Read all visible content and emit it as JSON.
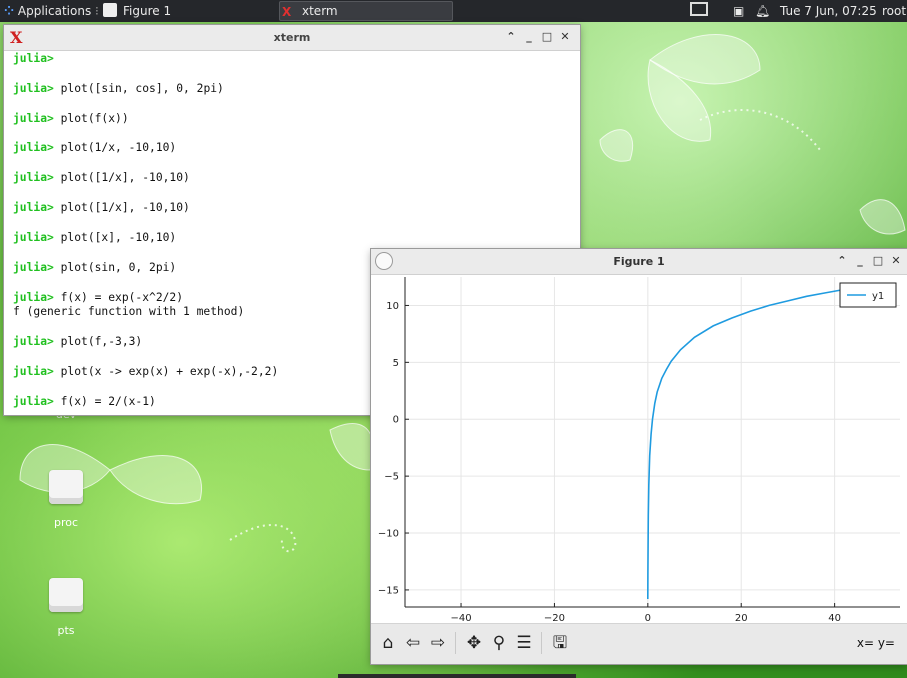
{
  "panel": {
    "applications_label": "Applications",
    "tasks": [
      {
        "label": "Figure 1",
        "icon": "figure-app-icon"
      },
      {
        "label": "xterm",
        "icon": "xterm-app-icon"
      }
    ],
    "clock": "Tue  7 Jun, 07:25",
    "user": "root"
  },
  "xterm": {
    "title": "xterm",
    "lines": [
      {
        "prompt": "julia>",
        "text": ""
      },
      {
        "prompt": "",
        "text": ""
      },
      {
        "prompt": "julia>",
        "text": " plot([sin, cos], 0, 2pi)"
      },
      {
        "prompt": "",
        "text": ""
      },
      {
        "prompt": "julia>",
        "text": " plot(f(x))"
      },
      {
        "prompt": "",
        "text": ""
      },
      {
        "prompt": "julia>",
        "text": " plot(1/x, -10,10)"
      },
      {
        "prompt": "",
        "text": ""
      },
      {
        "prompt": "julia>",
        "text": " plot([1/x], -10,10)"
      },
      {
        "prompt": "",
        "text": ""
      },
      {
        "prompt": "julia>",
        "text": " plot([1/x], -10,10)"
      },
      {
        "prompt": "",
        "text": ""
      },
      {
        "prompt": "julia>",
        "text": " plot([x], -10,10)"
      },
      {
        "prompt": "",
        "text": ""
      },
      {
        "prompt": "julia>",
        "text": " plot(sin, 0, 2pi)"
      },
      {
        "prompt": "",
        "text": ""
      },
      {
        "prompt": "julia>",
        "text": " f(x) = exp(-x^2/2)"
      },
      {
        "prompt": "",
        "text": "f (generic function with 1 method)"
      },
      {
        "prompt": "",
        "text": ""
      },
      {
        "prompt": "julia>",
        "text": " plot(f,-3,3)"
      },
      {
        "prompt": "",
        "text": ""
      },
      {
        "prompt": "julia>",
        "text": " plot(x -> exp(x) + exp(-x),-2,2)"
      },
      {
        "prompt": "",
        "text": ""
      },
      {
        "prompt": "julia>",
        "text": " f(x) = 2/(x-1)"
      }
    ]
  },
  "figure": {
    "title": "Figure 1",
    "coord_readout": "x= y=",
    "toolbar_icons": [
      "home-icon",
      "back-icon",
      "forward-icon",
      "pan-icon",
      "zoom-icon",
      "configure-subplots-icon",
      "save-icon"
    ]
  },
  "chart_data": {
    "type": "line",
    "title": "",
    "xlabel": "",
    "ylabel": "",
    "xlim": [
      -52,
      54
    ],
    "ylim": [
      -16.5,
      12.5
    ],
    "x_ticks": [
      -40,
      -20,
      0,
      20,
      40
    ],
    "x_tick_labels": [
      "−40",
      "−20",
      "0",
      "20",
      "40"
    ],
    "y_ticks": [
      -15,
      -10,
      -5,
      0,
      5,
      10
    ],
    "y_tick_labels": [
      "−15",
      "−10",
      "−5",
      "0",
      "5",
      "10"
    ],
    "grid": true,
    "legend_position": "top-right",
    "series": [
      {
        "name": "y1",
        "color": "#1f9be0",
        "x": [
          0.0,
          0.02,
          0.05,
          0.1,
          0.2,
          0.4,
          0.7,
          1.0,
          1.5,
          2.0,
          3.0,
          4.0,
          5.0,
          7.0,
          10.0,
          14.0,
          18.0,
          22.0,
          26.0,
          30.0,
          34.0,
          38.0,
          42.0,
          46.0
        ],
        "y": [
          -15.8,
          -13.6,
          -11.0,
          -8.5,
          -5.8,
          -3.2,
          -1.3,
          0.0,
          1.4,
          2.4,
          3.6,
          4.4,
          5.1,
          6.1,
          7.2,
          8.2,
          8.9,
          9.5,
          10.0,
          10.4,
          10.8,
          11.1,
          11.4,
          11.7
        ]
      }
    ]
  },
  "desktop": {
    "icons": [
      {
        "label": "dev"
      },
      {
        "label": "proc"
      },
      {
        "label": "pts"
      }
    ]
  }
}
